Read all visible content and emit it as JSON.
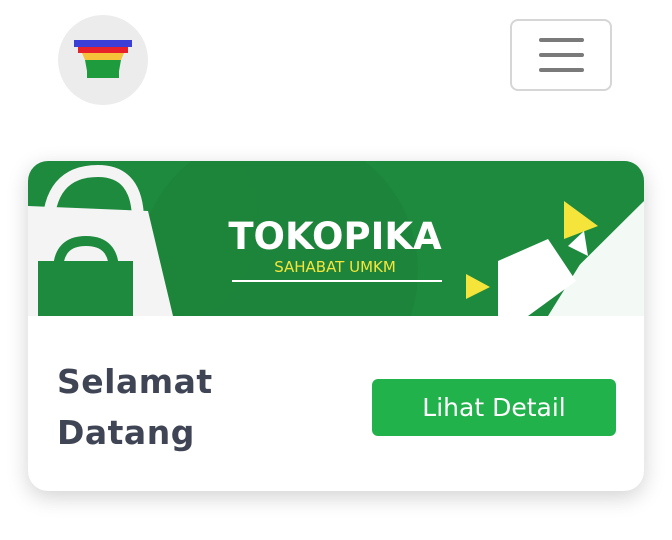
{
  "header": {
    "logo_icon": "tokopika-store-logo-icon",
    "menu_icon": "hamburger-menu-icon"
  },
  "banner": {
    "brand": "TOKOPIKA",
    "tagline": "SAHABAT UMKM",
    "icons": [
      "shopping-bag-icon",
      "shopping-bag-icon"
    ],
    "colors": {
      "green": "#1e8a3e",
      "dark_green": "#176e31",
      "accent": "#f5e53a"
    }
  },
  "card": {
    "welcome_line1": "Selamat",
    "welcome_line2": "Datang",
    "detail_button": "Lihat Detail",
    "button_color": "#22b24c"
  }
}
